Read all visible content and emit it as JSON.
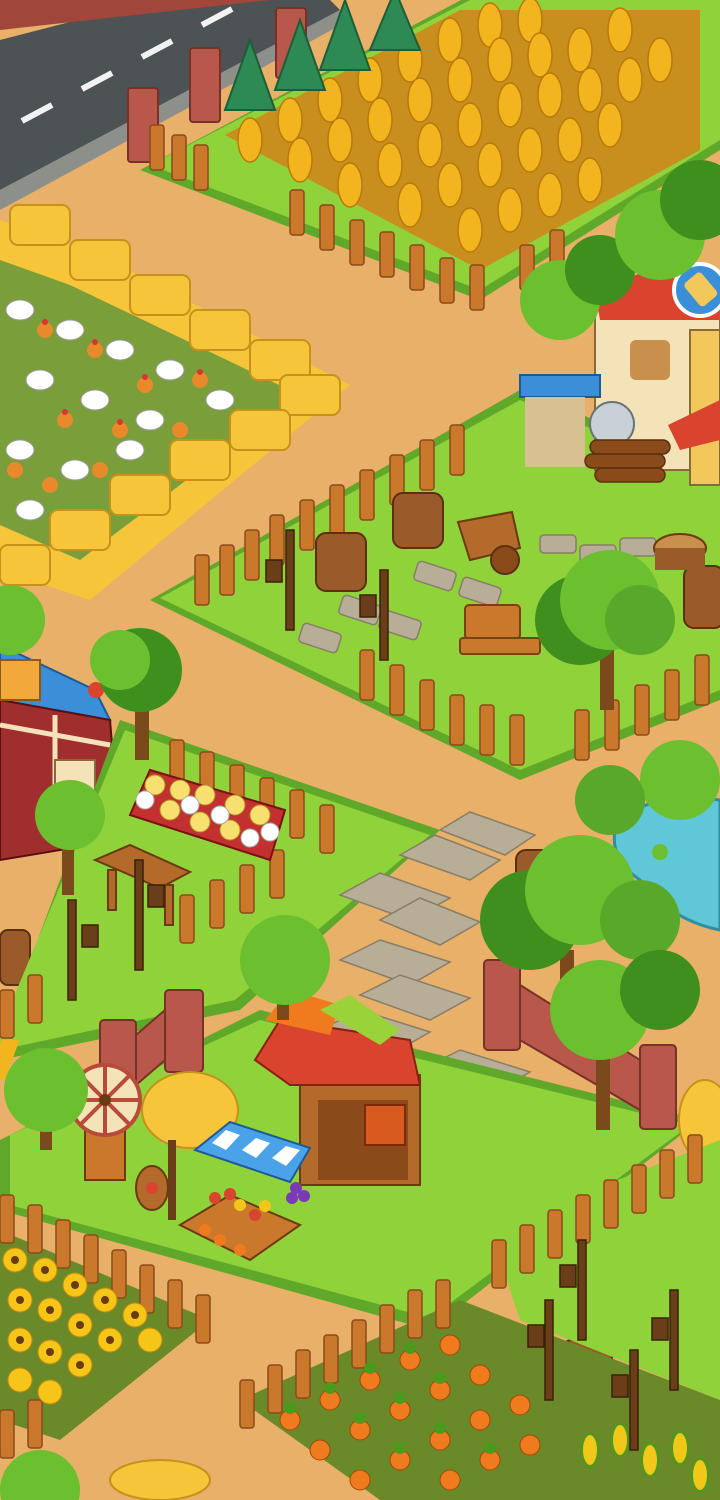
{
  "scene": {
    "type": "isometric-farm-map",
    "palette": {
      "dirt": "#e8b068",
      "dirt_dark": "#c98f4c",
      "grass": "#8fd23a",
      "grass_dark": "#5fa82a",
      "fence": "#c9782c",
      "fence_dark": "#8a4a1a",
      "wheat": "#f2b51e",
      "hay": "#f6c53a",
      "water": "#5fc7d8",
      "road": "#4d5254",
      "brick": "#b8584a",
      "stone": "#b8ae98",
      "tree": "#6cbf2f",
      "tree_dark": "#3f8f1e",
      "pine": "#2d8a55",
      "carrot": "#f07a1e",
      "sunflower": "#f5c518",
      "roof_red": "#d8442e",
      "roof_blue": "#3a8fd8",
      "awning_blue": "#4aa3e8",
      "barrel": "#9a5a2a"
    },
    "objects": [
      {
        "name": "road",
        "icon": "road"
      },
      {
        "name": "wheat-field",
        "icon": "wheat-icon"
      },
      {
        "name": "chicken-sheep-pen",
        "icon": "chicken-icon"
      },
      {
        "name": "sawmill",
        "icon": "sawmill-icon"
      },
      {
        "name": "barn",
        "icon": "barn-icon"
      },
      {
        "name": "flower-bed",
        "icon": "flower-icon"
      },
      {
        "name": "pond",
        "icon": "pond-icon"
      },
      {
        "name": "market-stall",
        "icon": "market-icon"
      },
      {
        "name": "windmill",
        "icon": "windmill-icon"
      },
      {
        "name": "sunflower-field",
        "icon": "sunflower-icon"
      },
      {
        "name": "carrot-field",
        "icon": "carrot-icon"
      },
      {
        "name": "wheelbarrow",
        "icon": "cart-icon"
      },
      {
        "name": "stone-path",
        "icon": "path-icon"
      }
    ]
  }
}
